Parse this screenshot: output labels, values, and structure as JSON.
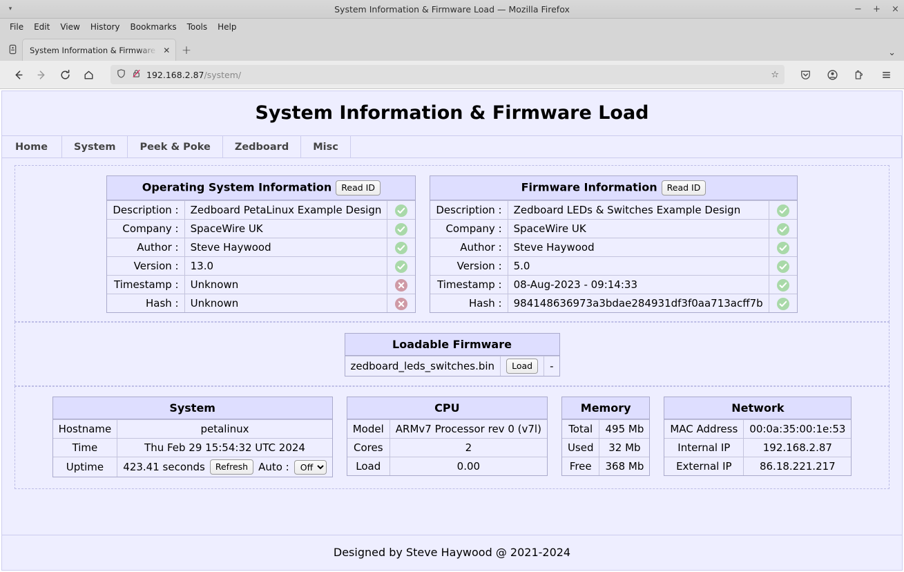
{
  "window": {
    "title": "System Information & Firmware Load — Mozilla Firefox",
    "minimize_label": "−",
    "maximize_label": "+",
    "close_label": "×"
  },
  "menubar": {
    "items": [
      {
        "label": "File"
      },
      {
        "label": "Edit"
      },
      {
        "label": "View"
      },
      {
        "label": "History"
      },
      {
        "label": "Bookmarks"
      },
      {
        "label": "Tools"
      },
      {
        "label": "Help"
      }
    ]
  },
  "tabstrip": {
    "tab_label": "System Information & Firmware L",
    "tab_close": "✕",
    "newtab_label": "+",
    "list_all_tabs": "⌄"
  },
  "navbar": {
    "back": "←",
    "forward": "→",
    "reload": "⟳",
    "home": "⌂",
    "url_host": "192.168.2.87",
    "url_path": "/system/",
    "bookmark_star": "☆"
  },
  "page": {
    "title": "System Information & Firmware Load",
    "tabs": [
      {
        "label": "Home"
      },
      {
        "label": "System"
      },
      {
        "label": "Peek & Poke"
      },
      {
        "label": "Zedboard"
      },
      {
        "label": "Misc"
      }
    ],
    "footer": "Designed by Steve Haywood @ 2021-2024"
  },
  "os_info": {
    "caption": "Operating System Information",
    "read_id_button": "Read ID",
    "rows": [
      {
        "label": "Description :",
        "value": "Zedboard PetaLinux Example Design",
        "status": "ok"
      },
      {
        "label": "Company :",
        "value": "SpaceWire UK",
        "status": "ok"
      },
      {
        "label": "Author :",
        "value": "Steve Haywood",
        "status": "ok"
      },
      {
        "label": "Version :",
        "value": "13.0",
        "status": "ok"
      },
      {
        "label": "Timestamp :",
        "value": "Unknown",
        "status": "bad"
      },
      {
        "label": "Hash :",
        "value": "Unknown",
        "status": "bad"
      }
    ]
  },
  "fw_info": {
    "caption": "Firmware Information",
    "read_id_button": "Read ID",
    "rows": [
      {
        "label": "Description :",
        "value": "Zedboard LEDs & Switches Example Design",
        "status": "ok"
      },
      {
        "label": "Company :",
        "value": "SpaceWire UK",
        "status": "ok"
      },
      {
        "label": "Author :",
        "value": "Steve Haywood",
        "status": "ok"
      },
      {
        "label": "Version :",
        "value": "5.0",
        "status": "ok"
      },
      {
        "label": "Timestamp :",
        "value": "08-Aug-2023 - 09:14:33",
        "status": "ok"
      },
      {
        "label": "Hash :",
        "value": "984148636973a3bdae284931df3f0aa713acff7b",
        "status": "ok"
      }
    ]
  },
  "loadable": {
    "caption": "Loadable Firmware",
    "filename": "zedboard_leds_switches.bin",
    "load_button": "Load",
    "status": "-"
  },
  "system": {
    "caption": "System",
    "hostname_label": "Hostname",
    "hostname_value": "petalinux",
    "time_label": "Time",
    "time_value": "Thu Feb 29 15:54:32 UTC 2024",
    "uptime_label": "Uptime",
    "uptime_value": "423.41 seconds",
    "refresh_button": "Refresh",
    "auto_label": "Auto :",
    "auto_value": "Off",
    "auto_options": [
      "Off"
    ]
  },
  "cpu": {
    "caption": "CPU",
    "rows": [
      {
        "label": "Model",
        "value": "ARMv7 Processor rev 0 (v7l)"
      },
      {
        "label": "Cores",
        "value": "2"
      },
      {
        "label": "Load",
        "value": "0.00"
      }
    ]
  },
  "memory": {
    "caption": "Memory",
    "rows": [
      {
        "label": "Total",
        "value": "495 Mb"
      },
      {
        "label": "Used",
        "value": "32 Mb"
      },
      {
        "label": "Free",
        "value": "368 Mb"
      }
    ]
  },
  "network": {
    "caption": "Network",
    "rows": [
      {
        "label": "MAC Address",
        "value": "00:0a:35:00:1e:53"
      },
      {
        "label": "Internal IP",
        "value": "192.168.2.87"
      },
      {
        "label": "External IP",
        "value": "86.18.221.217"
      }
    ]
  },
  "colors": {
    "page_bg": "#eeeeff",
    "caption_bg": "#dedeff",
    "border": "#aaaacc",
    "status_ok": "#a9d9a9",
    "status_bad": "#cf9aa6"
  }
}
